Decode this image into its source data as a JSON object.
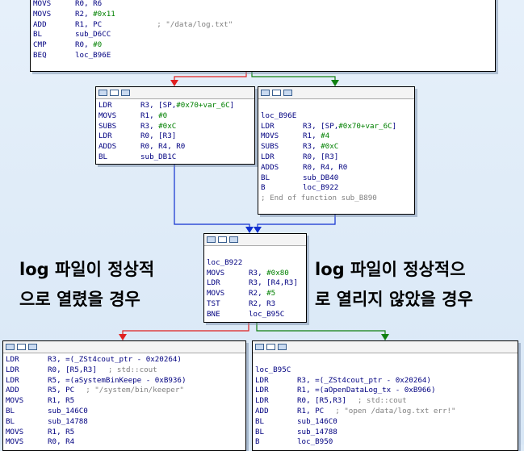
{
  "blocks": {
    "top": {
      "lines": [
        {
          "op": "MOVS",
          "a": "R0, R6",
          "c": ""
        },
        {
          "op": "MOVS",
          "a": "R2, #0x11",
          "c": ""
        },
        {
          "op": "ADD",
          "a": "R1, PC",
          "c": "; \"/data/log.txt\""
        },
        {
          "op": "BL",
          "a": "sub_D6CC",
          "c": ""
        },
        {
          "op": "CMP",
          "a": "R0, #0",
          "c": ""
        },
        {
          "op": "BEQ",
          "a": "loc_B96E",
          "c": ""
        }
      ]
    },
    "left1": {
      "lines": [
        {
          "op": "LDR",
          "a": "R3, [SP,#0x70+var_6C]",
          "c": ""
        },
        {
          "op": "MOVS",
          "a": "R1, #0",
          "c": ""
        },
        {
          "op": "SUBS",
          "a": "R3, #0xC",
          "c": ""
        },
        {
          "op": "LDR",
          "a": "R0, [R3]",
          "c": ""
        },
        {
          "op": "ADDS",
          "a": "R0, R4, R0",
          "c": ""
        },
        {
          "op": "BL",
          "a": "sub_DB1C",
          "c": ""
        }
      ]
    },
    "right1": {
      "label": "loc_B96E",
      "lines": [
        {
          "op": "LDR",
          "a": "R3, [SP,#0x70+var_6C]",
          "c": ""
        },
        {
          "op": "MOVS",
          "a": "R1, #4",
          "c": ""
        },
        {
          "op": "SUBS",
          "a": "R3, #0xC",
          "c": ""
        },
        {
          "op": "LDR",
          "a": "R0, [R3]",
          "c": ""
        },
        {
          "op": "ADDS",
          "a": "R0, R4, R0",
          "c": ""
        },
        {
          "op": "BL",
          "a": "sub_DB40",
          "c": ""
        },
        {
          "op": "B",
          "a": "loc_B922",
          "c": ""
        }
      ],
      "end_comment": "; End of function sub_B890"
    },
    "mid": {
      "label": "loc_B922",
      "lines": [
        {
          "op": "MOVS",
          "a": "R3, #0x80",
          "c": ""
        },
        {
          "op": "LDR",
          "a": "R3, [R4,R3]",
          "c": ""
        },
        {
          "op": "MOVS",
          "a": "R2, #5",
          "c": ""
        },
        {
          "op": "TST",
          "a": "R2, R3",
          "c": ""
        },
        {
          "op": "BNE",
          "a": "loc_B95C",
          "c": ""
        }
      ]
    },
    "bottom_left": {
      "lines": [
        {
          "op": "LDR",
          "a": "R3, =(_ZSt4cout_ptr - 0x20264)",
          "c": ""
        },
        {
          "op": "LDR",
          "a": "R0, [R5,R3]",
          "c": "; std::cout"
        },
        {
          "op": "LDR",
          "a": "R5, =(aSystemBinKeepe - 0xB936)",
          "c": ""
        },
        {
          "op": "ADD",
          "a": "R5, PC",
          "c": "; \"/system/bin/keeper\""
        },
        {
          "op": "MOVS",
          "a": "R1, R5",
          "c": ""
        },
        {
          "op": "BL",
          "a": "sub_146C0",
          "c": ""
        },
        {
          "op": "BL",
          "a": "sub_14788",
          "c": ""
        },
        {
          "op": "MOVS",
          "a": "R1, R5",
          "c": ""
        },
        {
          "op": "MOVS",
          "a": "R0, R4",
          "c": ""
        }
      ]
    },
    "bottom_right": {
      "label": "loc_B95C",
      "lines": [
        {
          "op": "LDR",
          "a": "R3, =(_ZSt4cout_ptr - 0x20264)",
          "c": ""
        },
        {
          "op": "LDR",
          "a": "R1, =(aOpenDataLog_tx - 0xB966)",
          "c": ""
        },
        {
          "op": "LDR",
          "a": "R0, [R5,R3]",
          "c": "; std::cout"
        },
        {
          "op": "ADD",
          "a": "R1, PC",
          "c": "; \"open /data/log.txt err!\""
        },
        {
          "op": "BL",
          "a": "sub_146C0",
          "c": ""
        },
        {
          "op": "BL",
          "a": "sub_14788",
          "c": ""
        },
        {
          "op": "B",
          "a": "loc_B950",
          "c": ""
        }
      ]
    }
  },
  "annotations": {
    "left_line1": "log 파일이 정상적",
    "left_line2": "으로 열렸을 경우",
    "right_line1": "log 파일이 정상적으",
    "right_line2": "로 열리지 않았을 경우"
  },
  "colors": {
    "false_edge": "#e02020",
    "true_edge": "#108010",
    "jump_edge": "#1030d0",
    "text": "#000080",
    "number": "#008000",
    "comment": "#7f7f7f"
  }
}
